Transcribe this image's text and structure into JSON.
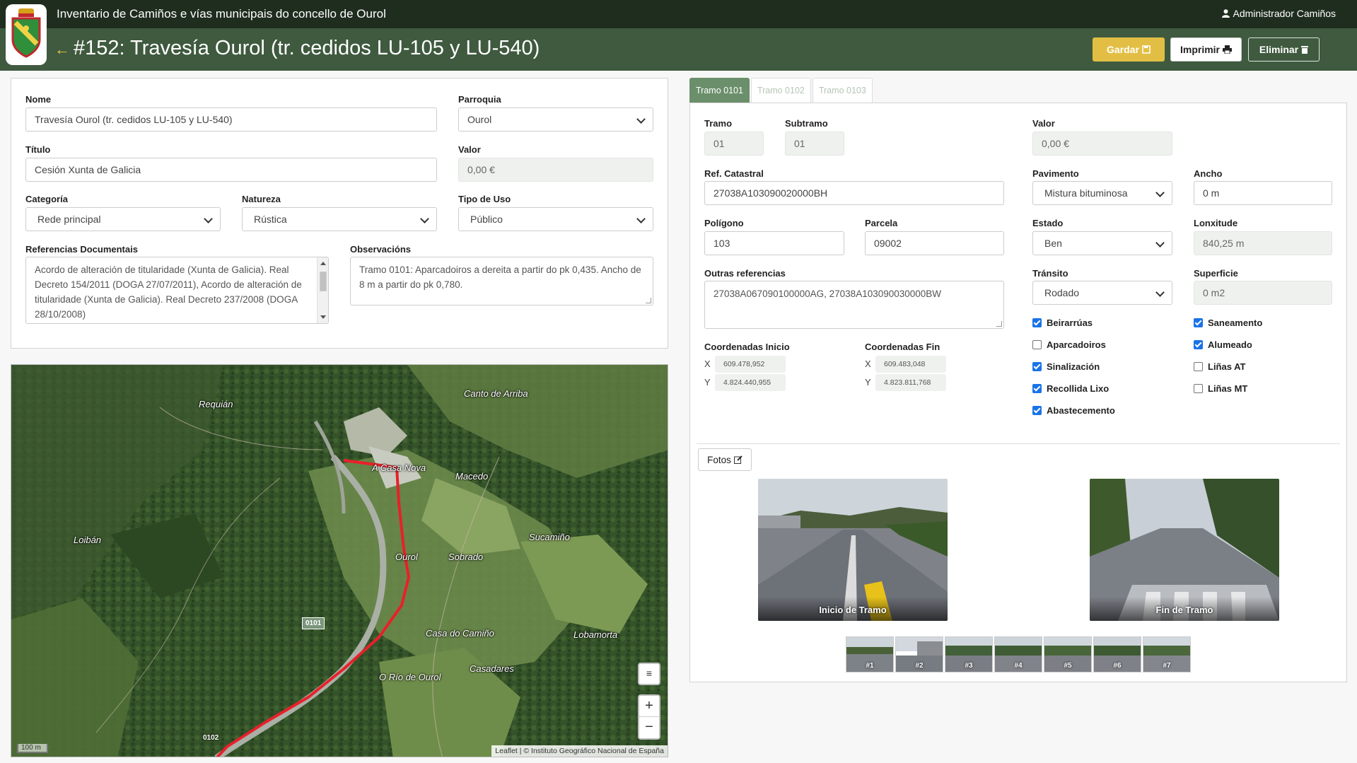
{
  "header": {
    "app_title": "Inventario de Camiños e vías municipais do concello de Ourol",
    "user": "Administrador Camiños",
    "page_title": "#152: Travesía Ourol (tr. cedidos LU-105 y LU-540)",
    "buttons": {
      "save": "Gardar",
      "print": "Imprimir",
      "delete": "Eliminar"
    }
  },
  "form": {
    "nome": {
      "label": "Nome",
      "value": "Travesía Ourol (tr. cedidos LU-105 y LU-540)"
    },
    "parroquia": {
      "label": "Parroquia",
      "value": "Ourol"
    },
    "titulo": {
      "label": "Título",
      "value": "Cesión Xunta de Galicia"
    },
    "valor": {
      "label": "Valor",
      "value": "0,00 €"
    },
    "categoria": {
      "label": "Categoría",
      "value": "Rede principal"
    },
    "natureza": {
      "label": "Natureza",
      "value": "Rústica"
    },
    "tipo_uso": {
      "label": "Tipo de Uso",
      "value": "Público"
    },
    "referencias": {
      "label": "Referencias Documentais",
      "value": "Acordo de alteración de titularidade (Xunta de Galicia). Real Decreto 154/2011 (DOGA 27/07/2011), Acordo de alteración de titularidade (Xunta de Galicia). Real Decreto 237/2008 (DOGA 28/10/2008)"
    },
    "observacions": {
      "label": "Observacións",
      "value": "Tramo 0101: Aparcadoiros a dereita a partir do pk 0,435. Ancho de 8 m a partir do pk 0,780."
    }
  },
  "map": {
    "places": [
      "Requián",
      "Canto de Arriba",
      "A Casa Nova",
      "Macedo",
      "Loibán",
      "Sucamiño",
      "Ourol",
      "Sobrado",
      "Casa do Camiño",
      "Lobamorta",
      "Casadares",
      "O Río de Ourol"
    ],
    "road_labels": [
      "0101",
      "0102"
    ],
    "scale": "100 m",
    "attribution": "Leaflet | © Instituto Geográfico Nacional de España",
    "zoom_in": "+",
    "zoom_out": "−"
  },
  "tramo": {
    "tabs": [
      "Tramo 0101",
      "Tramo 0102",
      "Tramo 0103"
    ],
    "tramo": {
      "label": "Tramo",
      "value": "01"
    },
    "subtramo": {
      "label": "Subtramo",
      "value": "01"
    },
    "valor": {
      "label": "Valor",
      "value": "0,00 €"
    },
    "ref_catastral": {
      "label": "Ref. Catastral",
      "value": "27038A103090020000BH"
    },
    "pavimento": {
      "label": "Pavimento",
      "value": "Mistura bituminosa"
    },
    "ancho": {
      "label": "Ancho",
      "value": "0 m"
    },
    "poligono": {
      "label": "Polígono",
      "value": "103"
    },
    "parcela": {
      "label": "Parcela",
      "value": "09002"
    },
    "estado": {
      "label": "Estado",
      "value": "Ben"
    },
    "lonxitude": {
      "label": "Lonxitude",
      "value": "840,25 m"
    },
    "outras": {
      "label": "Outras referencias",
      "value": "27038A067090100000AG, 27038A103090030000BW"
    },
    "transito": {
      "label": "Tránsito",
      "value": "Rodado"
    },
    "superficie": {
      "label": "Superficie",
      "value": "0 m2"
    },
    "checks_left": [
      {
        "label": "Beirarrúas",
        "checked": true
      },
      {
        "label": "Aparcadoiros",
        "checked": false
      },
      {
        "label": "Sinalización",
        "checked": true
      },
      {
        "label": "Recollida Lixo",
        "checked": true
      },
      {
        "label": "Abastecemento",
        "checked": true
      }
    ],
    "checks_right": [
      {
        "label": "Saneamento",
        "checked": true
      },
      {
        "label": "Alumeado",
        "checked": true
      },
      {
        "label": "Liñas AT",
        "checked": false
      },
      {
        "label": "Liñas MT",
        "checked": false
      }
    ],
    "coord_inicio": {
      "label": "Coordenadas Inicio",
      "x": "609.478,952",
      "y": "4.824.440,955"
    },
    "coord_fin": {
      "label": "Coordenadas Fin",
      "x": "609.483,048",
      "y": "4.823.811,768"
    },
    "axis_x": "X",
    "axis_y": "Y"
  },
  "fotos": {
    "button": "Fotos",
    "main": [
      {
        "caption": "Inicio de Tramo"
      },
      {
        "caption": "Fin de Tramo"
      }
    ],
    "thumbs": [
      "#1",
      "#2",
      "#3",
      "#4",
      "#5",
      "#6",
      "#7"
    ]
  },
  "colors": {
    "topbar": "#1f2d1f",
    "subbar": "#3f5a3f",
    "accent": "#e2bf44",
    "tab_active": "#6b8f6b",
    "route": "#e8202a"
  }
}
